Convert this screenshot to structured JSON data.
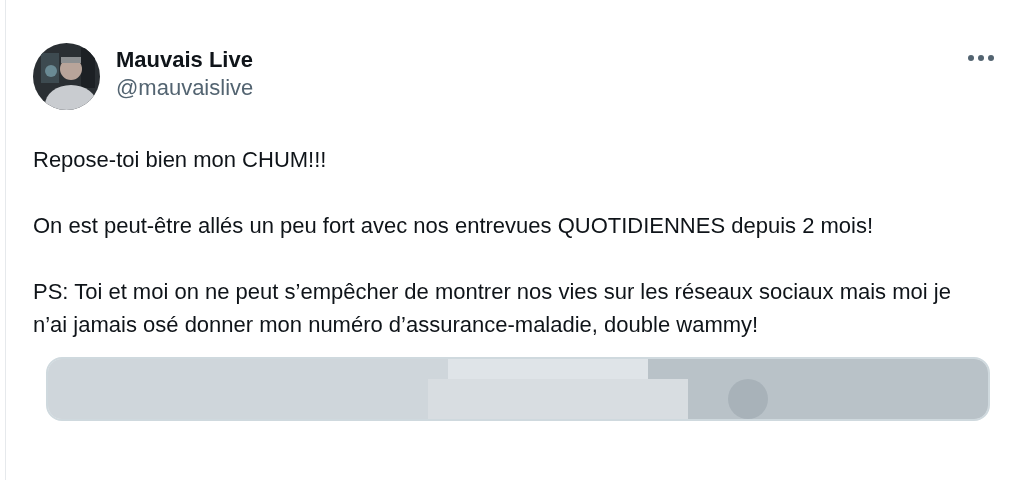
{
  "post": {
    "author": {
      "name": "Mauvais Live",
      "handle": "@mauvaislive"
    },
    "paragraphs": [
      "Repose-toi bien mon CHUM!!!",
      "On est peut-être allés un peu fort avec nos entrevues QUOTIDIENNES depuis 2 mois!",
      "PS: Toi et moi on ne peut s’empêcher de montrer nos vies sur les réseaux sociaux mais moi je n’ai jamais osé donner mon numéro d’assurance-maladie, double wammy!"
    ]
  }
}
